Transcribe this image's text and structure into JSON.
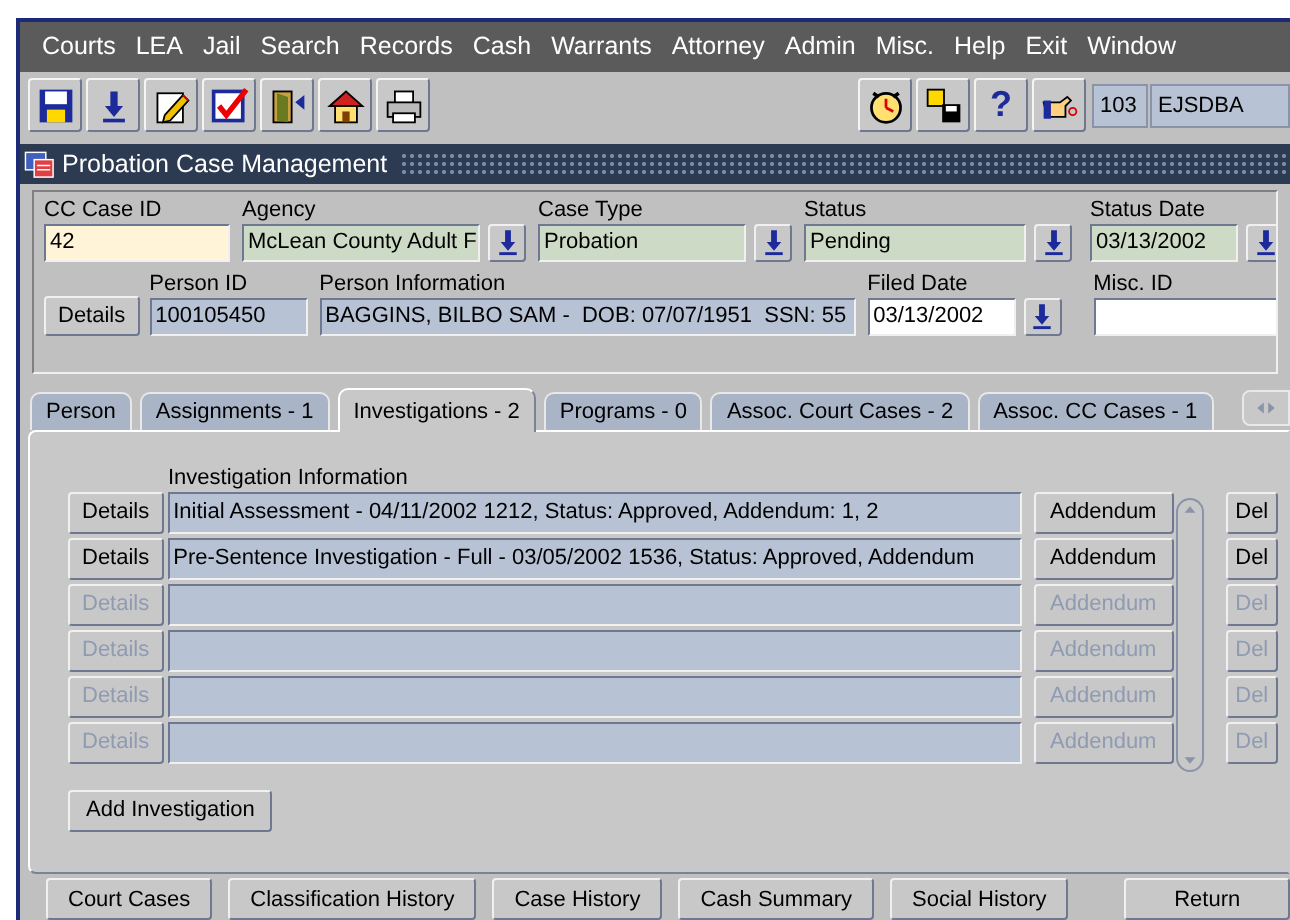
{
  "menu": [
    "Courts",
    "LEA",
    "Jail",
    "Search",
    "Records",
    "Cash",
    "Warrants",
    "Attorney",
    "Admin",
    "Misc.",
    "Help",
    "Exit",
    "Window"
  ],
  "session": {
    "code": "103",
    "user": "EJSDBA"
  },
  "help_button": "?",
  "window": {
    "title": "Probation Case Management"
  },
  "header": {
    "row_1": [
      {
        "label": "CC Case ID",
        "value": "42",
        "kind": "current",
        "lov": false
      },
      {
        "label": "Agency",
        "value": "McLean County Adult F",
        "kind": "required",
        "lov": true
      },
      {
        "label": "Case Type",
        "value": "Probation",
        "kind": "required",
        "lov": true
      },
      {
        "label": "Status",
        "value": "Pending",
        "kind": "required",
        "lov": true
      },
      {
        "label": "Status Date",
        "value": "03/13/2002",
        "kind": "required",
        "lov": true
      }
    ],
    "details_button": "Details",
    "row_2": [
      {
        "label": "Person ID",
        "value": "100105450",
        "kind": "readonly",
        "lov": false
      },
      {
        "label": "Person Information",
        "value": "BAGGINS, BILBO SAM -  DOB: 07/07/1951  SSN: 55",
        "kind": "readonly",
        "lov": false
      },
      {
        "label": "Filed Date",
        "value": "03/13/2002",
        "kind": "editable",
        "lov": true
      },
      {
        "label": "Misc. ID",
        "kind": "editable",
        "lov": false
      }
    ]
  },
  "tabs": [
    {
      "label": "Person",
      "selected": false
    },
    {
      "label": "Assignments - 1",
      "selected": false
    },
    {
      "label": "Investigations - 2",
      "selected": true
    },
    {
      "label": "Programs - 0",
      "selected": false
    },
    {
      "label": "Assoc. Court Cases - 2",
      "selected": false
    },
    {
      "label": "Assoc. CC Cases - 1",
      "selected": false
    }
  ],
  "investigation": {
    "heading": "Investigation Information",
    "rows": [
      {
        "details": "Details",
        "text": "Initial Assessment - 04/11/2002 1212, Status: Approved, Addendum: 1, 2",
        "addendum": "Addendum",
        "delete": "Del",
        "disabled": false
      },
      {
        "details": "Details",
        "text": "Pre-Sentence Investigation - Full - 03/05/2002 1536, Status: Approved, Addendum",
        "addendum": "Addendum",
        "delete": "Del",
        "disabled": false
      },
      {
        "details": "Details",
        "addendum": "Addendum",
        "delete": "Del",
        "disabled": true
      },
      {
        "details": "Details",
        "addendum": "Addendum",
        "delete": "Del",
        "disabled": true
      },
      {
        "details": "Details",
        "addendum": "Addendum",
        "delete": "Del",
        "disabled": true
      },
      {
        "details": "Details",
        "addendum": "Addendum",
        "delete": "Del",
        "disabled": true
      }
    ],
    "add_button": "Add Investigation"
  },
  "bottom_buttons": [
    "Court Cases",
    "Classification History",
    "Case History",
    "Cash Summary",
    "Social History",
    "Return"
  ]
}
